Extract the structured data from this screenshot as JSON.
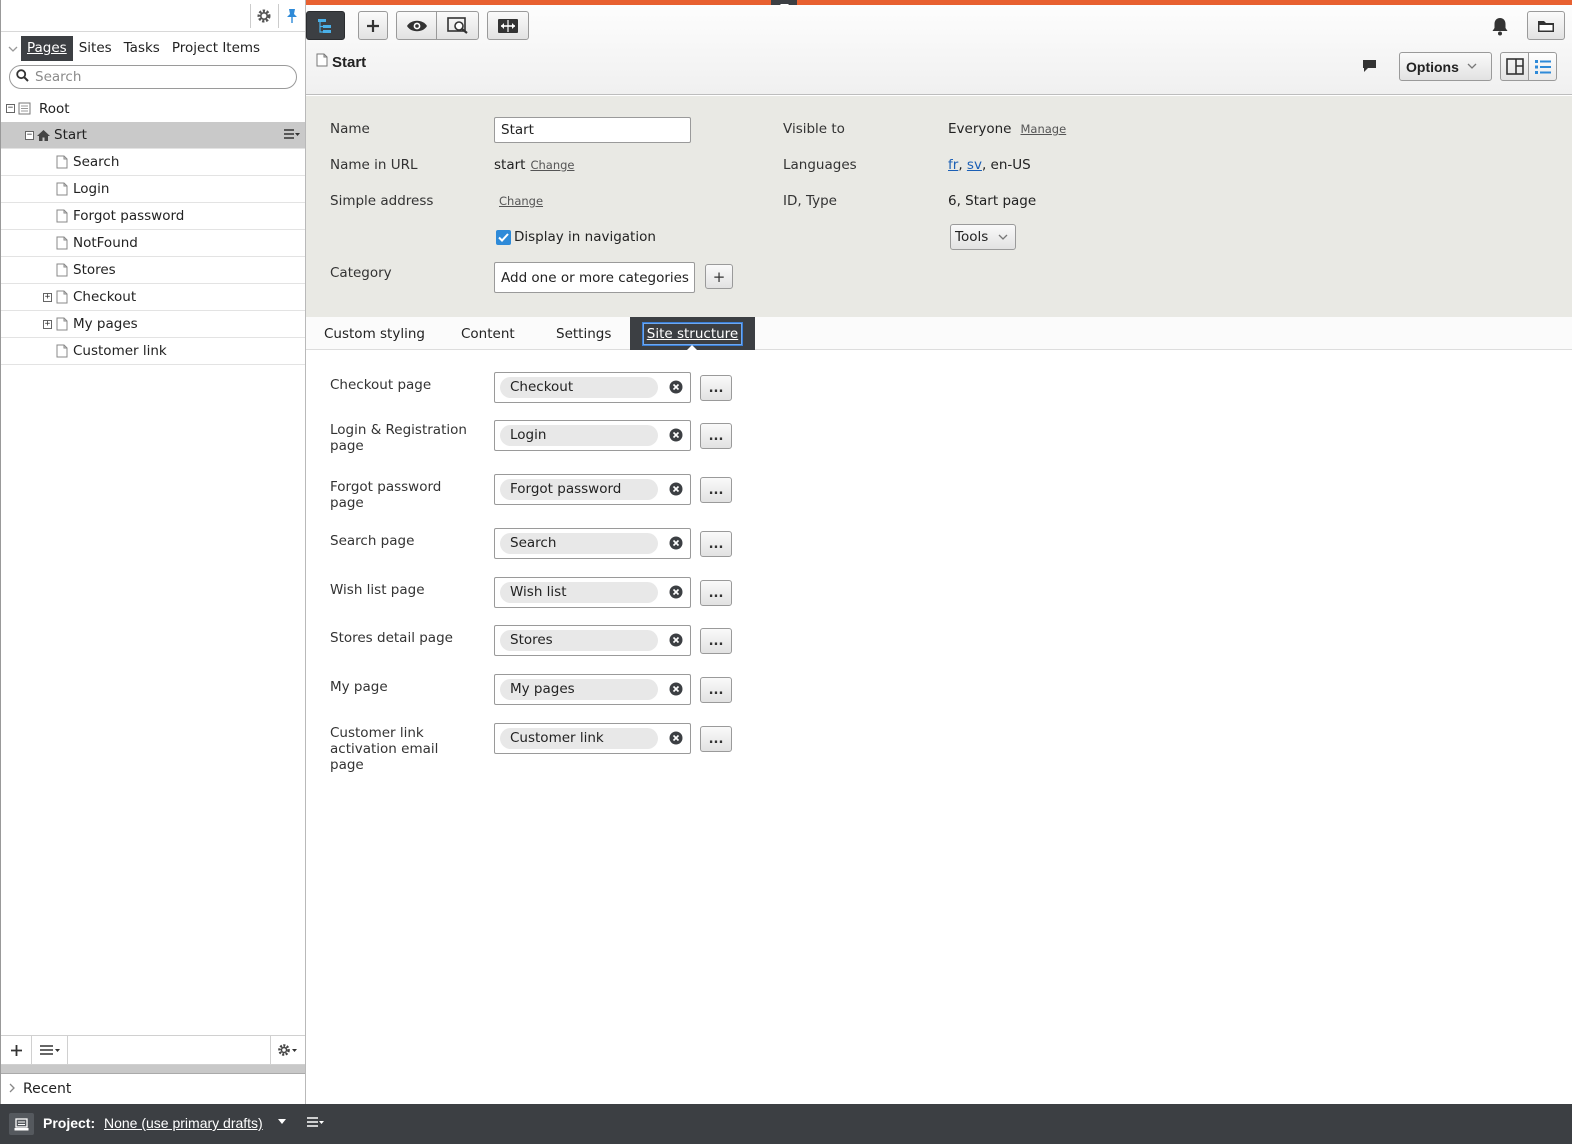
{
  "left_pane": {
    "tabs": [
      "Pages",
      "Sites",
      "Tasks",
      "Project Items"
    ],
    "active_tab": "Pages",
    "search": {
      "placeholder": "Search",
      "value": ""
    },
    "tree": [
      {
        "label": "Root",
        "level": 0,
        "expander": "minus",
        "icon": "root-icon"
      },
      {
        "label": "Start",
        "level": 1,
        "expander": "minus",
        "icon": "home-icon",
        "selected": true
      },
      {
        "label": "Search",
        "level": 2,
        "icon": "page-icon"
      },
      {
        "label": "Login",
        "level": 2,
        "icon": "page-icon"
      },
      {
        "label": "Forgot password",
        "level": 2,
        "icon": "page-icon"
      },
      {
        "label": "NotFound",
        "level": 2,
        "icon": "page-icon"
      },
      {
        "label": "Stores",
        "level": 2,
        "icon": "page-icon"
      },
      {
        "label": "Checkout",
        "level": 2,
        "expander": "plus",
        "icon": "page-icon"
      },
      {
        "label": "My pages",
        "level": 2,
        "expander": "plus",
        "icon": "page-icon"
      },
      {
        "label": "Customer link",
        "level": 2,
        "icon": "page-icon"
      }
    ],
    "recent_label": "Recent"
  },
  "header": {
    "page_title": "Start",
    "options_label": "Options"
  },
  "properties": {
    "name_label": "Name",
    "name_value": "Start",
    "name_in_url_label": "Name in URL",
    "name_in_url_value": "start",
    "change_label": "Change",
    "simple_address_label": "Simple address",
    "display_in_nav_label": "Display in navigation",
    "display_in_nav_checked": true,
    "category_label": "Category",
    "category_placeholder": "Add one or more categories",
    "category_add": "+",
    "visible_to_label": "Visible to",
    "visible_to_value": "Everyone",
    "manage_label": "Manage",
    "languages_label": "Languages",
    "languages": [
      "fr",
      "sv",
      "en-US"
    ],
    "id_type_label": "ID, Type",
    "id_type_value": "6, Start page",
    "tools_label": "Tools"
  },
  "tabs": [
    "Custom styling",
    "Content",
    "Settings",
    "Site structure"
  ],
  "active_tab": "Site structure",
  "site_structure": [
    {
      "label": "Checkout page",
      "value": "Checkout"
    },
    {
      "label": "Login & Registration page",
      "value": "Login"
    },
    {
      "label": "Forgot password page",
      "value": "Forgot password"
    },
    {
      "label": "Search page",
      "value": "Search"
    },
    {
      "label": "Wish list page",
      "value": "Wish list"
    },
    {
      "label": "Stores detail page",
      "value": "Stores"
    },
    {
      "label": "My page",
      "value": "My pages"
    },
    {
      "label": "Customer link activation email page",
      "value": "Customer link"
    }
  ],
  "browse_label": "...",
  "statusbar": {
    "project_label": "Project:",
    "project_value": "None (use primary drafts)"
  },
  "colors": {
    "accent_orange": "#e86030",
    "dark_bar": "#3c3f43",
    "link_blue": "#1b5fb5",
    "checkbox_blue": "#2e8ad8",
    "props_bg": "#e9e9e4"
  }
}
